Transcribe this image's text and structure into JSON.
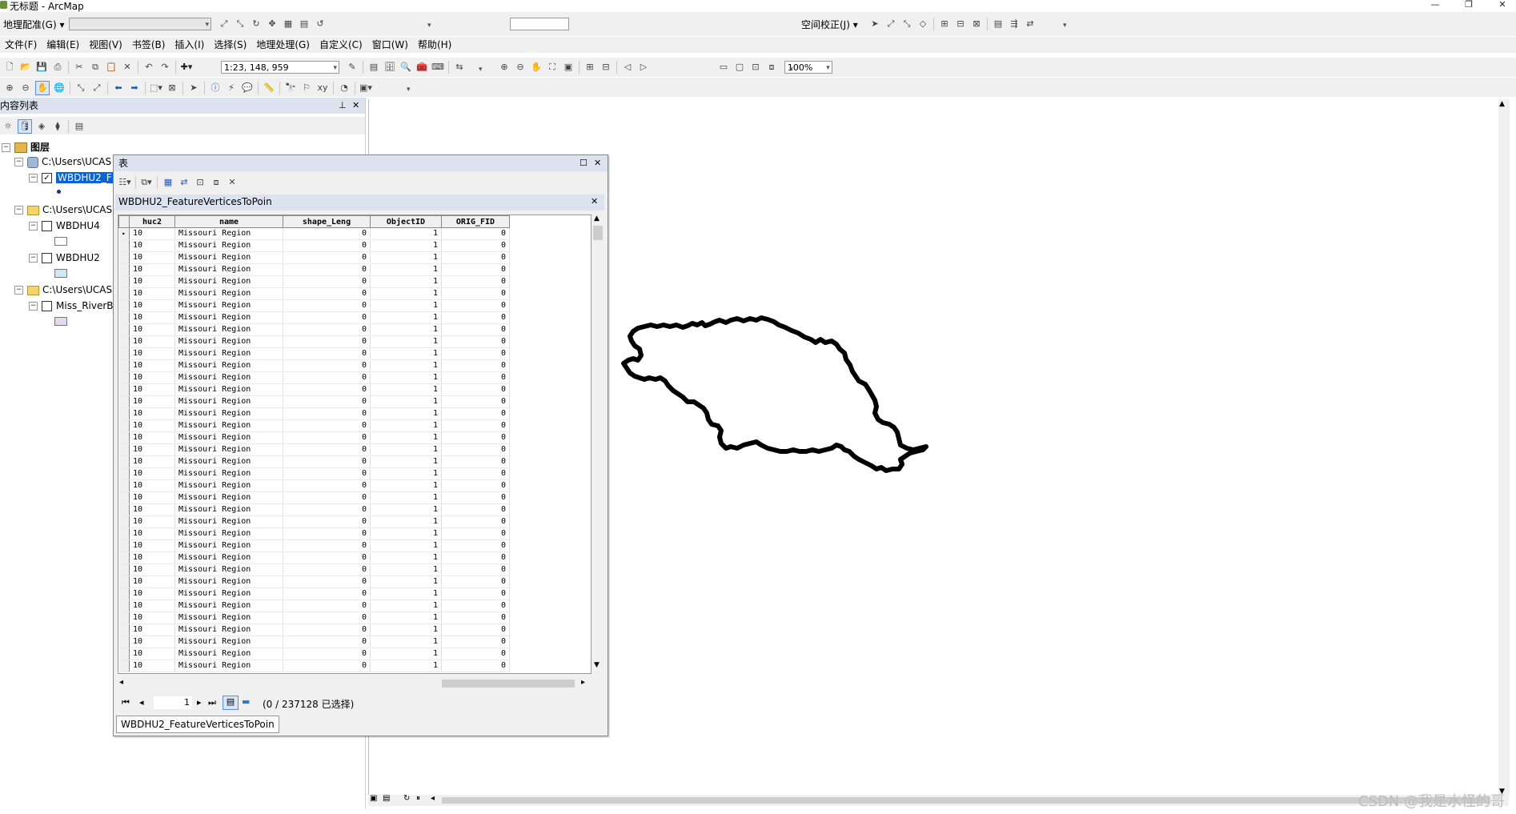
{
  "window": {
    "title": "无标题 - ArcMap",
    "controls": [
      "—",
      "❐",
      "✕"
    ]
  },
  "georef_toolbar": {
    "label": "地理配准(G) ▾",
    "layer_combo": "",
    "spatial_adjust_label": "空间校正(J) ▾"
  },
  "menu": {
    "items": [
      "文件(F)",
      "编辑(E)",
      "视图(V)",
      "书签(B)",
      "插入(I)",
      "选择(S)",
      "地理处理(G)",
      "自定义(C)",
      "窗口(W)",
      "帮助(H)"
    ]
  },
  "standard_toolbar": {
    "scale": "1:23, 148, 959",
    "zoom_percent": "100%"
  },
  "toc": {
    "title": "内容列表",
    "root_label": "图层",
    "groups": [
      {
        "path": "C:\\Users\\UCAS",
        "layers": [
          {
            "name": "WBDHU2_F",
            "checked": true,
            "selected": true
          }
        ]
      },
      {
        "path": "C:\\Users\\UCAS",
        "layers": [
          {
            "name": "WBDHU4",
            "checked": false
          },
          {
            "name": "WBDHU2",
            "checked": false
          }
        ]
      },
      {
        "path": "C:\\Users\\UCAS",
        "layers": [
          {
            "name": "Miss_RiverB",
            "checked": false
          }
        ]
      }
    ]
  },
  "table_window": {
    "title": "表",
    "table_name": "WBDHU2_FeatureVerticesToPoin",
    "columns": [
      "huc2",
      "name",
      "shape_Leng",
      "ObjectID",
      "ORIG_FID"
    ],
    "row_values": [
      "10",
      "Missouri Region",
      "0",
      "1",
      "0"
    ],
    "visible_rows": 37,
    "record_number": "1",
    "selection_status": "(0 / 237128 已选择)",
    "tab_label": "WBDHU2_FeatureVerticesToPoin"
  },
  "map": {
    "feature_color": "#000000"
  },
  "watermark": "CSDN @我是水怪的哥",
  "colors": {
    "title_panel_bg": "#dbe3ee",
    "selection_highlight": "#0a64d8",
    "toolbar_bg": "#f0f0f0"
  }
}
